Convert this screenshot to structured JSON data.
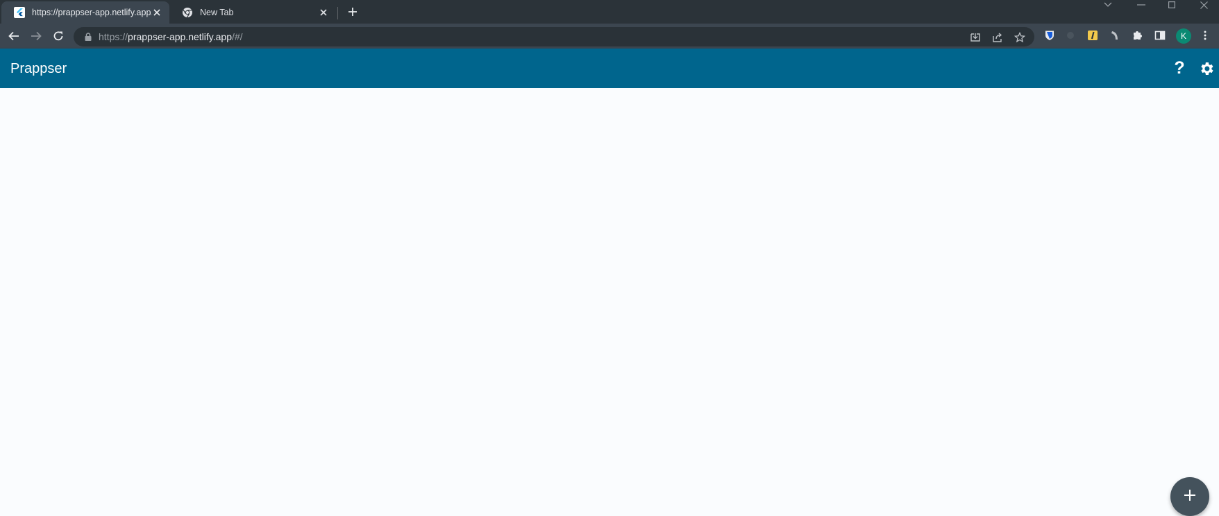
{
  "browser": {
    "tabs": [
      {
        "title": "https://prappser-app.netlify.app/",
        "active": true
      },
      {
        "title": "New Tab",
        "active": false
      }
    ],
    "url": {
      "scheme": "https://",
      "host": "prappser-app.netlify.app",
      "path": "/#/"
    },
    "profile_initial": "K"
  },
  "app": {
    "title": "Prappser",
    "help_label": "?",
    "theme_color": "#00658d",
    "fab_color": "#44525c"
  },
  "icons": {
    "tab1_favicon": "flutter-icon",
    "tab2_favicon": "chrome-icon",
    "settings": "gear-icon",
    "fab": "plus-icon"
  }
}
